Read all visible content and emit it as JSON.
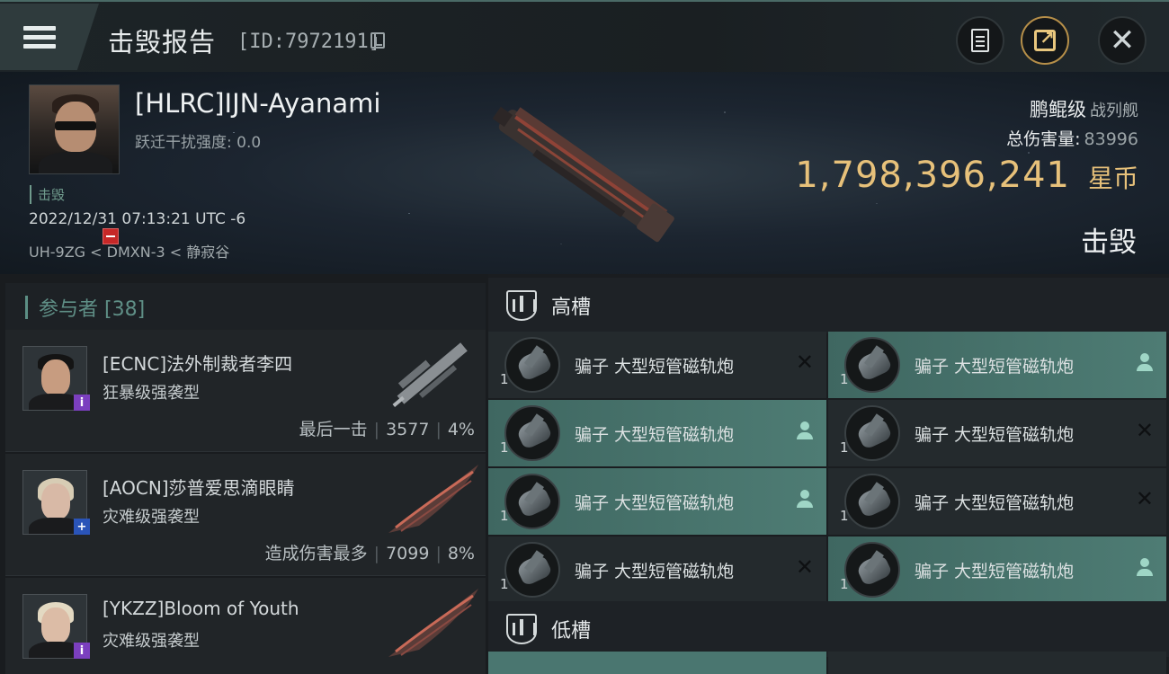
{
  "header": {
    "title": "击毁报告",
    "report_id": "[ID:7972191]",
    "menu_icon": "hamburger-menu-icon",
    "actions": [
      {
        "name": "report-button",
        "icon": "document-icon"
      },
      {
        "name": "share-button",
        "icon": "share-external-icon"
      },
      {
        "name": "close-button",
        "icon": "close-icon"
      }
    ]
  },
  "victim": {
    "name": "[HLRC]IJN-Ayanami",
    "warp_disruption_label": "跃迁干扰强度: 0.0",
    "kill_tag": "击毁",
    "timestamp": "2022/12/31 07:13:21 UTC -6",
    "location": "UH-9ZG < DMXN-3 < 静寂谷",
    "ship_name": "鹏鲲级",
    "ship_type": "战列舰",
    "total_damage_label": "总伤害量:",
    "total_damage": "83996",
    "isk_value": "1,798,396,241",
    "isk_unit": "星币",
    "status": "击毁"
  },
  "participants": {
    "header": "参与者 [38]",
    "items": [
      {
        "name": "[ECNC]法外制裁者李四",
        "ship": "狂暴级强袭型",
        "stat_label": "最后一击",
        "damage": "3577",
        "percent": "4%",
        "badge_color": "#7b3fbf",
        "badge_glyph": "i"
      },
      {
        "name": "[AOCN]莎普爱思滴眼睛",
        "ship": "灾难级强袭型",
        "stat_label": "造成伤害最多",
        "damage": "7099",
        "percent": "8%",
        "badge_color": "#2a54b8",
        "badge_glyph": "+"
      },
      {
        "name": "[YKZZ]Bloom of Youth",
        "ship": "灾难级强袭型",
        "stat_label": "",
        "damage": "",
        "percent": "",
        "badge_color": "#7b3fbf",
        "badge_glyph": "i"
      }
    ]
  },
  "fittings": {
    "high_slot_title": "高槽",
    "low_slot_title": "低槽",
    "high_modules": [
      {
        "name": "骗子 大型短管磁轨炮",
        "qty": "1",
        "state": "destroyed"
      },
      {
        "name": "骗子 大型短管磁轨炮",
        "qty": "1",
        "state": "dropped"
      },
      {
        "name": "骗子 大型短管磁轨炮",
        "qty": "1",
        "state": "dropped"
      },
      {
        "name": "骗子 大型短管磁轨炮",
        "qty": "1",
        "state": "destroyed"
      },
      {
        "name": "骗子 大型短管磁轨炮",
        "qty": "1",
        "state": "dropped"
      },
      {
        "name": "骗子 大型短管磁轨炮",
        "qty": "1",
        "state": "destroyed"
      },
      {
        "name": "骗子 大型短管磁轨炮",
        "qty": "1",
        "state": "destroyed"
      },
      {
        "name": "骗子 大型短管磁轨炮",
        "qty": "1",
        "state": "dropped"
      }
    ]
  },
  "colors": {
    "accent_teal": "#5c8f85",
    "isk_gold": "#e7c17a",
    "dropped_highlight": "#4e7c74"
  }
}
